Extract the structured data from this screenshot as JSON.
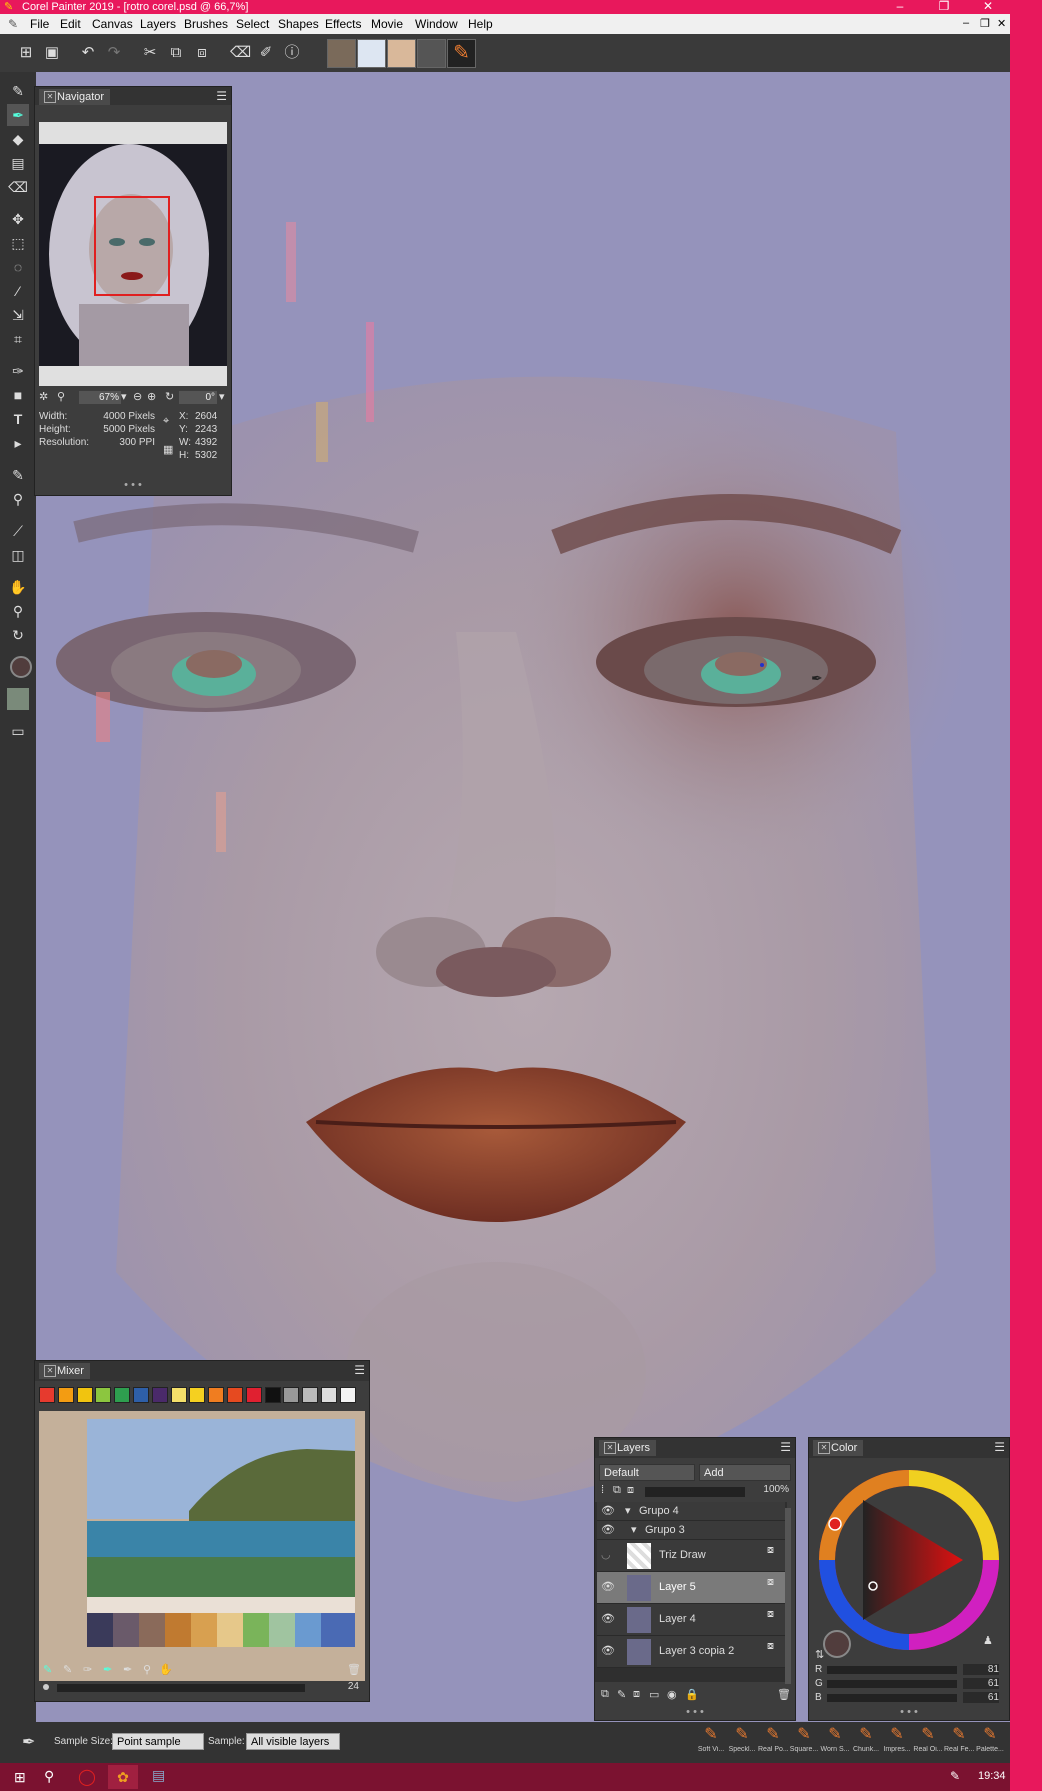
{
  "window": {
    "title": "Corel Painter 2019 - [rotro corel.psd @ 66,7%]",
    "clock": "19:34"
  },
  "menu": [
    "File",
    "Edit",
    "Canvas",
    "Layers",
    "Brushes",
    "Select",
    "Shapes",
    "Effects",
    "Movie",
    "Window",
    "Help"
  ],
  "navigator": {
    "tab": "Navigator",
    "zoom": "67%",
    "rotation": "0°",
    "width_label": "Width:",
    "width_value": "4000 Pixels",
    "height_label": "Height:",
    "height_value": "5000 Pixels",
    "resolution_label": "Resolution:",
    "resolution_value": "300 PPI",
    "x_label": "X:",
    "x_value": "2604",
    "y_label": "Y:",
    "y_value": "2243",
    "w_label": "W:",
    "w_value": "4392",
    "h_label": "H:",
    "h_value": "5302"
  },
  "mixer": {
    "tab": "Mixer",
    "swatches": [
      "#e63a2e",
      "#f39c12",
      "#f1c40f",
      "#8cc63f",
      "#2e9e4f",
      "#2e5fa8",
      "#4a2a6a",
      "#f5e06a",
      "#f5d020",
      "#f07d20",
      "#e64a20",
      "#e02030",
      "#111111",
      "#999999",
      "#bbbbbb",
      "#dddddd",
      "#f4f4f4"
    ],
    "brush_size": "24"
  },
  "layers": {
    "tab": "Layers",
    "composite_method": "Default",
    "composite_depth": "Add",
    "opacity": "100%",
    "rows": [
      {
        "name": "Grupo 4",
        "type": "group"
      },
      {
        "name": "Grupo 3",
        "type": "group"
      },
      {
        "name": "Triz Draw",
        "type": "layer"
      },
      {
        "name": "Layer 5",
        "type": "layer",
        "selected": true
      },
      {
        "name": "Layer 4",
        "type": "layer"
      },
      {
        "name": "Layer 3 copia 2",
        "type": "layer"
      }
    ]
  },
  "color": {
    "tab": "Color",
    "r_label": "R",
    "r_value": "81",
    "g_label": "G",
    "g_value": "61",
    "b_label": "B",
    "b_value": "61",
    "current_color": "#513d3d"
  },
  "propbar": {
    "sample_size_label": "Sample Size:",
    "sample_size_value": "Point sample",
    "sample_label": "Sample:",
    "sample_value": "All visible layers"
  },
  "brush_strip": [
    "Soft Vi...",
    "Speckl...",
    "Real Po...",
    "Square...",
    "Worn S...",
    "Chunk...",
    "Impres...",
    "Real Oi...",
    "Real Fe...",
    "Palette..."
  ]
}
